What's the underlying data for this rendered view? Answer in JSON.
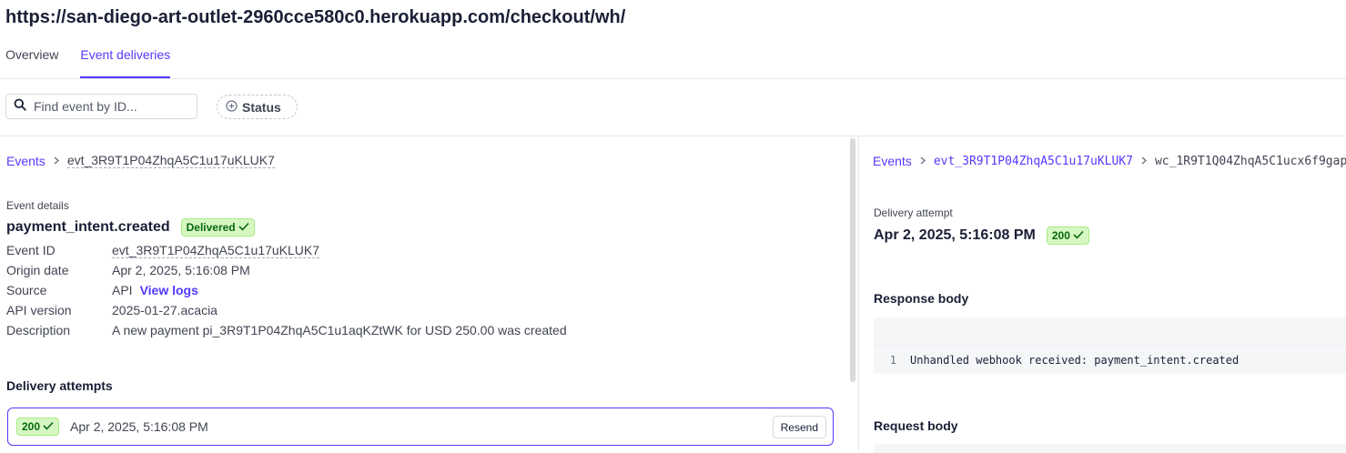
{
  "page": {
    "url_title": "https://san-diego-art-outlet-2960cce580c0.herokuapp.com/checkout/wh/"
  },
  "tabs": [
    {
      "label": "Overview",
      "active": false
    },
    {
      "label": "Event deliveries",
      "active": true
    }
  ],
  "filters": {
    "search_placeholder": "Find event by ID...",
    "status_label": "Status"
  },
  "left": {
    "breadcrumb": {
      "root": "Events",
      "current": "evt_3R9T1P04ZhqA5C1u17uKLUK7"
    },
    "event_details_label": "Event details",
    "event_type": "payment_intent.created",
    "status_badge": "Delivered",
    "details": {
      "event_id_label": "Event ID",
      "event_id": "evt_3R9T1P04ZhqA5C1u17uKLUK7",
      "origin_date_label": "Origin date",
      "origin_date": "Apr 2, 2025, 5:16:08 PM",
      "source_label": "Source",
      "source": "API",
      "view_logs": "View logs",
      "api_version_label": "API version",
      "api_version": "2025-01-27.acacia",
      "description_label": "Description",
      "description": "A new payment pi_3R9T1P04ZhqA5C1u1aqKZtWK for USD 250.00 was created"
    },
    "delivery_attempts_title": "Delivery attempts",
    "attempt": {
      "code": "200",
      "date": "Apr 2, 2025, 5:16:08 PM",
      "resend_label": "Resend"
    }
  },
  "right": {
    "breadcrumb": {
      "root": "Events",
      "event": "evt_3R9T1P04ZhqA5C1u17uKLUK7",
      "current": "wc_1R9T1Q04ZhqA5C1ucx6f9gap"
    },
    "delivery_attempt_label": "Delivery attempt",
    "attempt_date": "Apr 2, 2025, 5:16:08 PM",
    "attempt_code": "200",
    "response_body_title": "Response body",
    "response_line_no": "1",
    "response_line": "Unhandled webhook received: payment_intent.created",
    "request_body_title": "Request body"
  },
  "colors": {
    "accent": "#533afd",
    "success_bg": "#d7f7c2",
    "success_text": "#05690d"
  },
  "icons": {
    "search": "search-icon",
    "status_add": "plus-circle-icon",
    "check": "check-icon",
    "chevron": "chevron-right-icon"
  }
}
